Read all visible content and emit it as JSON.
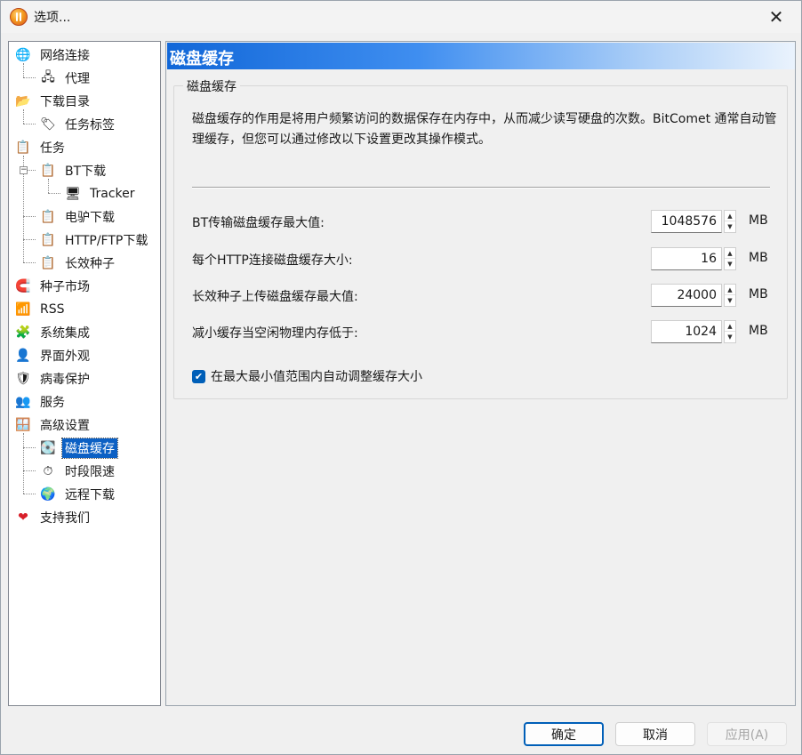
{
  "window": {
    "title": "选项...",
    "close_glyph": "✕"
  },
  "tree": {
    "items": [
      {
        "label": "网络连接",
        "icon": "globe-icon",
        "glyph": "🌐"
      },
      {
        "label": "代理",
        "icon": "network-globe-icon",
        "glyph": "🖧"
      },
      {
        "label": "下载目录",
        "icon": "folder-icon",
        "glyph": "📂"
      },
      {
        "label": "任务标签",
        "icon": "tag-icon",
        "glyph": "🏷"
      },
      {
        "label": "任务",
        "icon": "clipboard-icon",
        "glyph": "📋"
      },
      {
        "label": "BT下载",
        "icon": "clipboard-icon",
        "glyph": "📋"
      },
      {
        "label": "Tracker",
        "icon": "server-icon",
        "glyph": "🖥"
      },
      {
        "label": "电驴下载",
        "icon": "clipboard-icon",
        "glyph": "📋"
      },
      {
        "label": "HTTP/FTP下载",
        "icon": "clipboard-icon",
        "glyph": "📋"
      },
      {
        "label": "长效种子",
        "icon": "clipboard-icon",
        "glyph": "📋"
      },
      {
        "label": "种子市场",
        "icon": "magnet-icon",
        "glyph": "🧲"
      },
      {
        "label": "RSS",
        "icon": "rss-icon",
        "glyph": "📶"
      },
      {
        "label": "系统集成",
        "icon": "puzzle-icon",
        "glyph": "🧩"
      },
      {
        "label": "界面外观",
        "icon": "user-monitor-icon",
        "glyph": "👤"
      },
      {
        "label": "病毒保护",
        "icon": "shield-icon",
        "glyph": "🛡"
      },
      {
        "label": "服务",
        "icon": "users-icon",
        "glyph": "👥"
      },
      {
        "label": "高级设置",
        "icon": "settings-window-icon",
        "glyph": "🪟"
      },
      {
        "label": "磁盘缓存",
        "icon": "disk-icon",
        "glyph": "💽"
      },
      {
        "label": "时段限速",
        "icon": "clock-icon",
        "glyph": "⏱"
      },
      {
        "label": "远程下载",
        "icon": "earth-icon",
        "glyph": "🌍"
      },
      {
        "label": "支持我们",
        "icon": "heart-icon",
        "glyph": "❤"
      }
    ]
  },
  "panel": {
    "header_title": "磁盘缓存",
    "group_title": "磁盘缓存",
    "description": "磁盘缓存的作用是将用户频繁访问的数据保存在内存中，从而减少读写硬盘的次数。BitComet 通常自动管理缓存，但您可以通过修改以下设置更改其操作模式。",
    "fields": [
      {
        "label": "BT传输磁盘缓存最大值:",
        "value": "1048576",
        "unit": "MB"
      },
      {
        "label": "每个HTTP连接磁盘缓存大小:",
        "value": "16",
        "unit": "MB"
      },
      {
        "label": "长效种子上传磁盘缓存最大值:",
        "value": "24000",
        "unit": "MB"
      },
      {
        "label": "减小缓存当空闲物理内存低于:",
        "value": "1024",
        "unit": "MB"
      }
    ],
    "auto_adjust": {
      "label": "在最大最小值范围内自动调整缓存大小",
      "checked": true
    }
  },
  "buttons": {
    "ok": "确定",
    "cancel": "取消",
    "apply": "应用(A)"
  },
  "colors": {
    "selection": "#0c60c4",
    "header_start": "#1167d8",
    "checkbox": "#005fb8"
  }
}
